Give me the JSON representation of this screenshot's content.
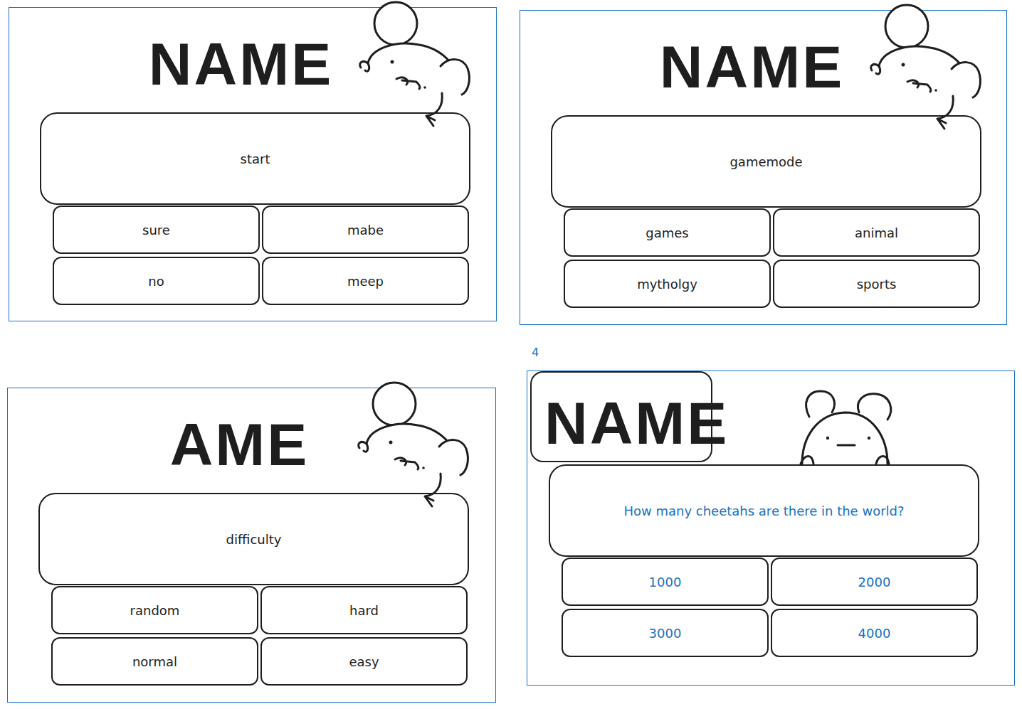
{
  "frames": [
    {
      "kind": "menu",
      "title": "NAME",
      "prompt": "start",
      "options": [
        "sure",
        "mabe",
        "no",
        "meep"
      ],
      "color": "#1e1e1e"
    },
    {
      "kind": "menu",
      "title": "NAME",
      "prompt": "gamemode",
      "options": [
        "games",
        "animal",
        "mytholgy",
        "sports"
      ],
      "color": "#1e1e1e"
    },
    {
      "kind": "menu",
      "title": "AME",
      "prompt": "difficulty",
      "options": [
        "random",
        "hard",
        "normal",
        "easy"
      ],
      "color": "#1e1e1e"
    },
    {
      "kind": "question",
      "label": "4",
      "title": "NAME",
      "prompt": "How many cheetahs are there in the world?",
      "options": [
        "1000",
        "2000",
        "3000",
        "4000"
      ],
      "color": "#1971c2"
    }
  ]
}
